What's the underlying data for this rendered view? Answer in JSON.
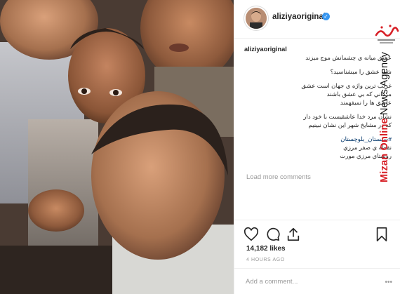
{
  "post": {
    "username": "aliziyaoriginal",
    "caption_user": "aliziyaoriginal",
    "caption_first_line": "عشق ميانه ي چشمانش موج ميزند",
    "caption_lines_1": [
      "شما عشق را ميشناسيد؟"
    ],
    "caption_lines_2": [
      "غريب ترين واژه ي جهان است عشق",
      "مرداني كه بي عشق باشند",
      "عاشق ها را نميفهمند"
    ],
    "caption_lines_3": [
      "نشان مرد خدا عاشقيست با خود دار",
      "كه در مشايخ شهر اين نشان نبينيم"
    ],
    "hashtag": "#سيستان_بلوچستان",
    "caption_lines_4": [
      "نقطه ي صفر مرزي",
      "روستاي مرزي مورت"
    ],
    "load_more": "Load more comments",
    "likes": "14,182 likes",
    "timestamp": "4 HOURS AGO",
    "comment_placeholder": "Add a comment...",
    "more_glyph": "•••"
  },
  "icons": {
    "verified": "verified-badge-icon",
    "like": "heart-icon",
    "comment": "comment-icon",
    "share": "share-icon",
    "save": "bookmark-icon"
  },
  "watermark": {
    "brand_red": "Mizan Online",
    "brand_black": "News Agency",
    "logo_text": "ميزان",
    "logo_sub": "خبرگزاري"
  },
  "colors": {
    "verified": "#3897f0",
    "text": "#262626",
    "muted": "#999999",
    "hashtag": "#003569",
    "brand_red": "#d71f26"
  }
}
